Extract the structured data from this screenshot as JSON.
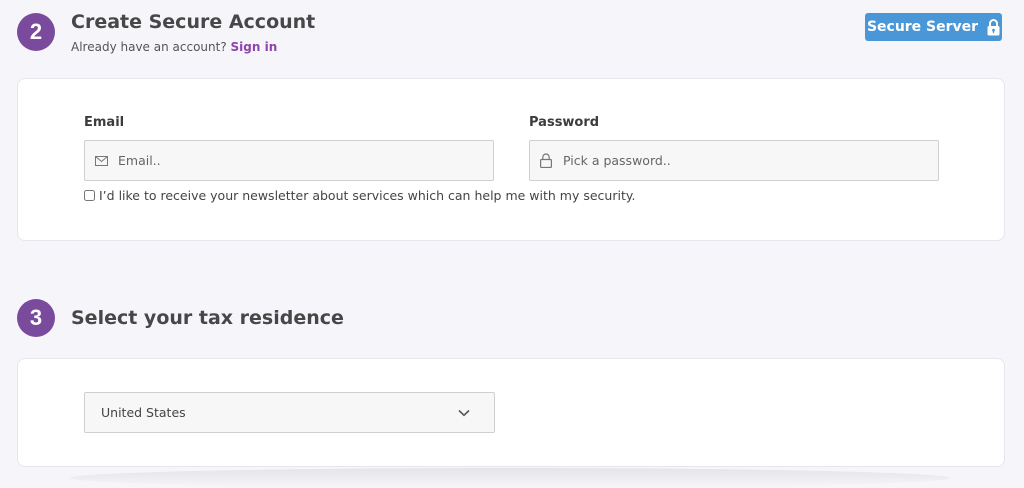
{
  "step2": {
    "number": "2",
    "title": "Create Secure Account",
    "subtitle_text": "Already have an account?",
    "signin_label": "Sign in"
  },
  "secure_server": {
    "label": "Secure Server",
    "icon": "lock-icon"
  },
  "account_form": {
    "email_label": "Email",
    "email_placeholder": "Email..",
    "email_icon": "envelope-icon",
    "password_label": "Password",
    "password_placeholder": "Pick a password..",
    "password_icon": "lock-icon",
    "newsletter_label": "I’d like to receive your newsletter about services which can help me with my security.",
    "newsletter_checked": false
  },
  "step3": {
    "number": "3",
    "title": "Select your tax residence"
  },
  "tax_residence": {
    "selected": "United States",
    "icon": "chevron-down-icon"
  },
  "colors": {
    "badge": "#7a4a9c",
    "link": "#8e44ad",
    "secure_button": "#4a97d8",
    "background": "#f6f6fa"
  }
}
